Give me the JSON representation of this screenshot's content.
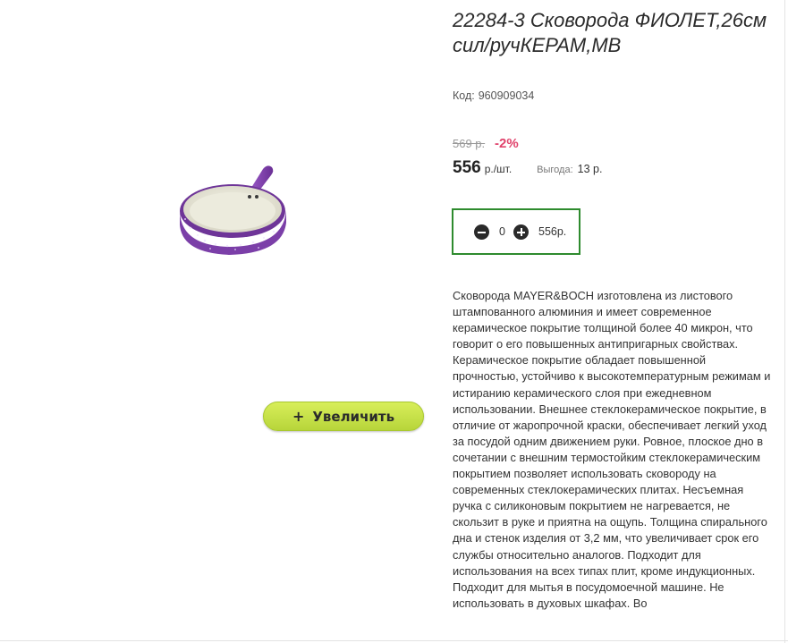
{
  "product": {
    "title": "22284-3 Сковорода ФИОЛЕТ,26см сил/ручКЕРАМ,МВ",
    "code_label": "Код:",
    "code_value": "960909034",
    "image": "frying-pan-purple-ceramic"
  },
  "pricing": {
    "old_price": "569 р.",
    "discount": "-2%",
    "price": "556",
    "unit": "р./шт.",
    "savings_label": "Выгода:",
    "savings_value": "13 р."
  },
  "quantity": {
    "value": "0",
    "total": "556р."
  },
  "zoom_button": {
    "icon": "+",
    "label": "Увеличить"
  },
  "description": "Сковорода MAYER&BOCH изготовлена из листового штампованного алюминия и имеет современное керамическое покрытие толщиной более 40 микрон, что говорит о его повышенных антипригарных свойствах. Керамическое покрытие обладает повышенной прочностью, устойчиво к высокотемпературным режимам и истиранию керамического слоя при ежедневном использовании. Внешнее стеклокерамическое покрытие, в отличие от жаропрочной краски, обеспечивает легкий уход за посудой одним движением руки. Ровное, плоское дно в сочетании с внешним термостойким стеклокерамическим покрытием позволяет использовать сковороду на современных стеклокерамических плитах. Несъемная ручка с силиконовым покрытием не нагревается, не скользит в руке и приятна на ощупь. Толщина спирального дна и стенок изделия от 3,2 мм, что увеличивает срок его службы относительно аналогов. Подходит для использования на всех типах плит, кроме индукционных. Подходит для мытья в посудомоечной машине. Не использовать в духовых шкафах. Во",
  "colors": {
    "accent_green": "#2e8b2e",
    "discount_red": "#e0426b",
    "button_lime": "#c8e34a",
    "pan_purple": "#7b3fa8"
  }
}
